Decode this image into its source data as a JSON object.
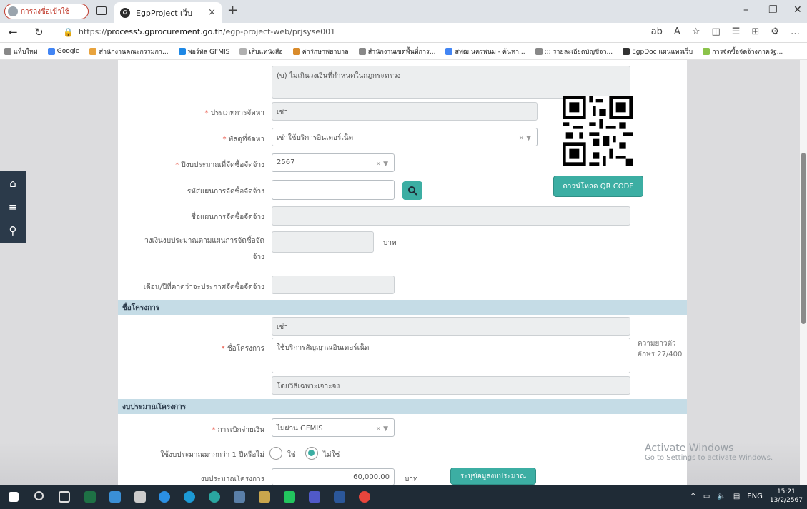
{
  "browser": {
    "profile_label": "การลงชื่อเข้าใช้",
    "tab_title": "EgpProject เว็บ",
    "tab_favicon": "EgpProject",
    "url_prefix": "https://",
    "url_host": "process5.gprocurement.go.th",
    "url_path": "/egp-project-web/prjsyse001",
    "bookmarks": [
      "แท็บใหม่",
      "Google",
      "สำนักงานคณะกรรมกา...",
      "พอร์ทัล GFMIS",
      "เสิบแหนังสือ",
      "ค่ารักษาพยาบาล",
      "สำนักงานเขตพื้นที่การ...",
      "สพฒ.นครพนม - ค้นหา...",
      "::: รายละเอียดบัญชีจา...",
      "EgpDoc แผนแทรเว็บ",
      "การจัดซื้อจัดจ้างภาครัฐ..."
    ]
  },
  "form": {
    "top_textarea": "(ข) ไม่เกินวงเงินที่กำหนดในกฎกระทรวง",
    "procurement_type": {
      "label": "ประเภทการจัดหา",
      "value": "เช่า"
    },
    "item": {
      "label": "พัสดุที่จัดหา",
      "value": "เช่าใช้บริการอินเตอร์เน็ต"
    },
    "budget_year": {
      "label": "ปีงบประมาณที่จัดซื้อจัดจ้าง",
      "value": "2567"
    },
    "plan_code": {
      "label": "รหัสแผนการจัดซื้อจัดจ้าง",
      "value": ""
    },
    "plan_name": {
      "label": "ชื่อแผนการจัดซื้อจัดจ้าง",
      "value": ""
    },
    "plan_budget": {
      "label_line1": "วงเงินงบประมาณตามแผนการจัดซื้อจัด",
      "label_line2": "จ้าง",
      "value": "",
      "unit": "บาท"
    },
    "announce_month": {
      "label": "เดือน/ปีที่คาดว่าจะประกาศจัดซื้อจัดจ้าง",
      "value": ""
    },
    "qr_button": "ดาวน์โหลด QR CODE"
  },
  "project": {
    "section_title": "ชื่อโครงการ",
    "prefix": "เช่า",
    "name_label": "ชื่อโครงการ",
    "name_value": "ใช้บริการสัญญาณอินเตอร์เน็ต",
    "suffix": "โดยวิธีเฉพาะเจาะจง",
    "counter_line1": "ความยาวตัว",
    "counter_line2": "อักษร 27/400"
  },
  "budget": {
    "section_title": "งบประมาณโครงการ",
    "disbursement": {
      "label": "การเบิกจ่ายเงิน",
      "value": "ไม่ผ่าน GFMIS"
    },
    "multi_year": {
      "label": "ใช้งบประมาณมากกว่า 1 ปีหรือไม่",
      "yes": "ใช่",
      "no": "ไม่ใช่"
    },
    "project_budget": {
      "label": "งบประมาณโครงการ",
      "value": "60,000.00",
      "unit": "บาท"
    },
    "specify_button": "ระบุข้อมูลงบประมาณ"
  },
  "watermark": {
    "title": "Activate Windows",
    "subtitle": "Go to Settings to activate Windows."
  },
  "taskbar": {
    "lang": "ENG",
    "time": "15:21",
    "date": "13/2/2567"
  },
  "colors": {
    "teal": "#3caea3",
    "section": "#c5dce6",
    "required": "#e74c3c"
  }
}
